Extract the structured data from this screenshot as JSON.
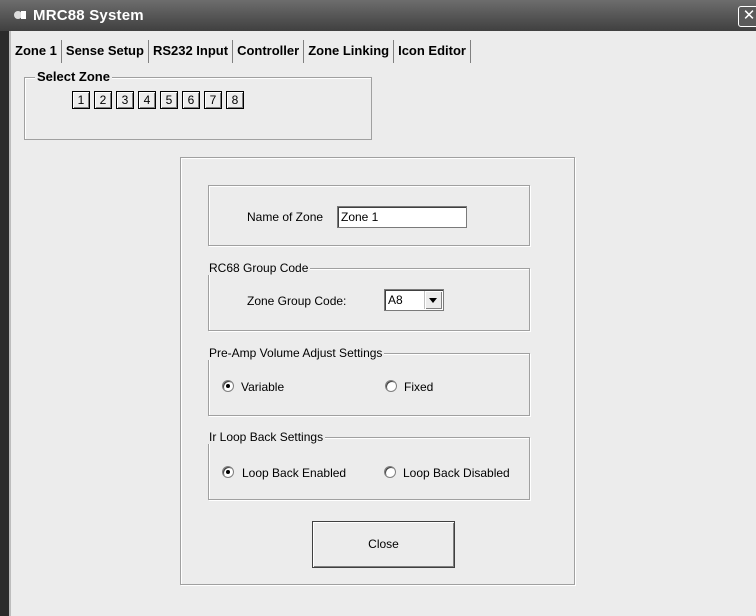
{
  "window": {
    "title": "MRC88 System",
    "close_glyph": "✕",
    "app_icon": "app-icon"
  },
  "tabs": [
    {
      "label": "Zone 1",
      "active": true
    },
    {
      "label": "Sense Setup"
    },
    {
      "label": "RS232 Input"
    },
    {
      "label": "Controller"
    },
    {
      "label": "Zone Linking"
    },
    {
      "label": "Icon Editor"
    }
  ],
  "select_zone": {
    "legend": "Select Zone",
    "zones": [
      "1",
      "2",
      "3",
      "4",
      "5",
      "6",
      "7",
      "8"
    ]
  },
  "zone_name": {
    "label": "Name of Zone",
    "value": "Zone 1"
  },
  "group_code": {
    "legend": "RC68 Group Code",
    "label": "Zone Group Code:",
    "value": "A8"
  },
  "preamp": {
    "legend": "Pre-Amp Volume Adjust Settings",
    "opt1": "Variable",
    "opt2": "Fixed",
    "selected": "Variable"
  },
  "ir_loop": {
    "legend": "Ir Loop Back Settings",
    "opt1": "Loop Back Enabled",
    "opt2": "Loop Back Disabled",
    "selected": "Loop Back Enabled"
  },
  "close_button": "Close"
}
